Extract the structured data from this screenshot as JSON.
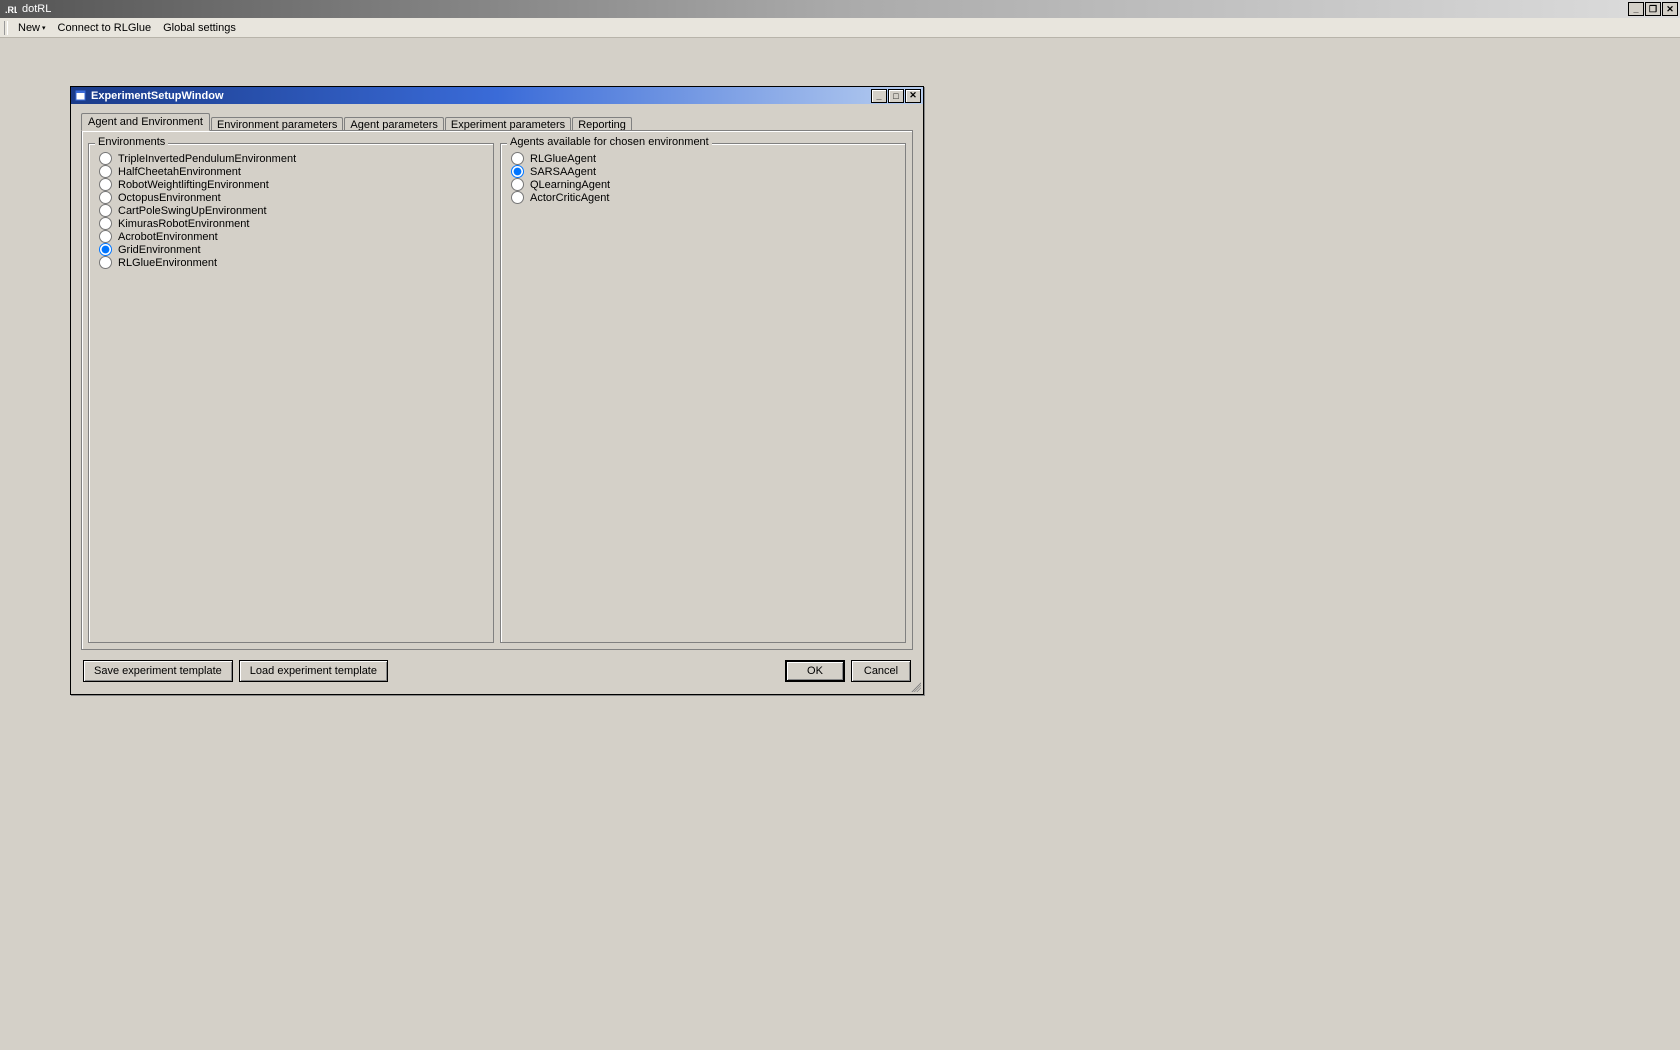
{
  "app": {
    "title": "dotRL",
    "menu": {
      "new": "New",
      "connect": "Connect to RLGlue",
      "global": "Global settings"
    }
  },
  "childWindow": {
    "title": "ExperimentSetupWindow",
    "tabs": [
      {
        "label": "Agent and Environment",
        "active": true
      },
      {
        "label": "Environment parameters",
        "active": false
      },
      {
        "label": "Agent parameters",
        "active": false
      },
      {
        "label": "Experiment parameters",
        "active": false
      },
      {
        "label": "Reporting",
        "active": false
      }
    ],
    "environments": {
      "legend": "Environments",
      "items": [
        {
          "label": "TripleInvertedPendulumEnvironment",
          "selected": false
        },
        {
          "label": "HalfCheetahEnvironment",
          "selected": false
        },
        {
          "label": "RobotWeightliftingEnvironment",
          "selected": false
        },
        {
          "label": "OctopusEnvironment",
          "selected": false
        },
        {
          "label": "CartPoleSwingUpEnvironment",
          "selected": false
        },
        {
          "label": "KimurasRobotEnvironment",
          "selected": false
        },
        {
          "label": "AcrobotEnvironment",
          "selected": false
        },
        {
          "label": "GridEnvironment",
          "selected": true
        },
        {
          "label": "RLGlueEnvironment",
          "selected": false
        }
      ]
    },
    "agents": {
      "legend": "Agents available for chosen environment",
      "items": [
        {
          "label": "RLGlueAgent",
          "selected": false
        },
        {
          "label": "SARSAAgent",
          "selected": true
        },
        {
          "label": "QLearningAgent",
          "selected": false
        },
        {
          "label": "ActorCriticAgent",
          "selected": false
        }
      ]
    },
    "buttons": {
      "saveTemplate": "Save experiment template",
      "loadTemplate": "Load experiment template",
      "ok": "OK",
      "cancel": "Cancel"
    }
  }
}
